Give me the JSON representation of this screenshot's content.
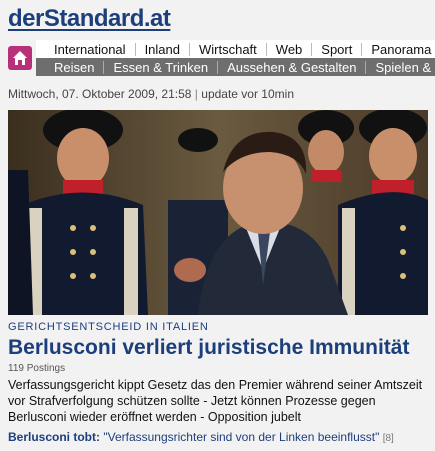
{
  "site": {
    "logo": "derStandard.at"
  },
  "nav": {
    "primary": [
      "International",
      "Inland",
      "Wirtschaft",
      "Web",
      "Sport",
      "Panorama"
    ],
    "secondary": [
      "Reisen",
      "Essen & Trinken",
      "Aussehen & Gestalten",
      "Spielen & Lese"
    ]
  },
  "dateline": {
    "date": "Mittwoch, 07. Oktober 2009, 21:58",
    "separator": "|",
    "update": "update vor 10min"
  },
  "article": {
    "kicker": "Gerichtsentscheid in Italien",
    "headline": "Berlusconi verliert juristische Immunität",
    "postings": "119 Postings",
    "teaser": "Verfassungsgericht kippt Gesetz das den Premier während seiner Amtszeit vor Strafverfolgung schützen sollte - Jetzt können Prozesse gegen Berlusconi wieder eröffnet werden - Opposition jubelt"
  },
  "related": {
    "lead": "Berlusconi tobt:",
    "quote": "\"Verfassungsrichter sind von der Linken beeinflusst\"",
    "count": "[8]"
  },
  "colors": {
    "brand_blue": "#1c3f7c",
    "home_magenta": "#b9307a",
    "subnav_gray": "#6e6e6e"
  }
}
